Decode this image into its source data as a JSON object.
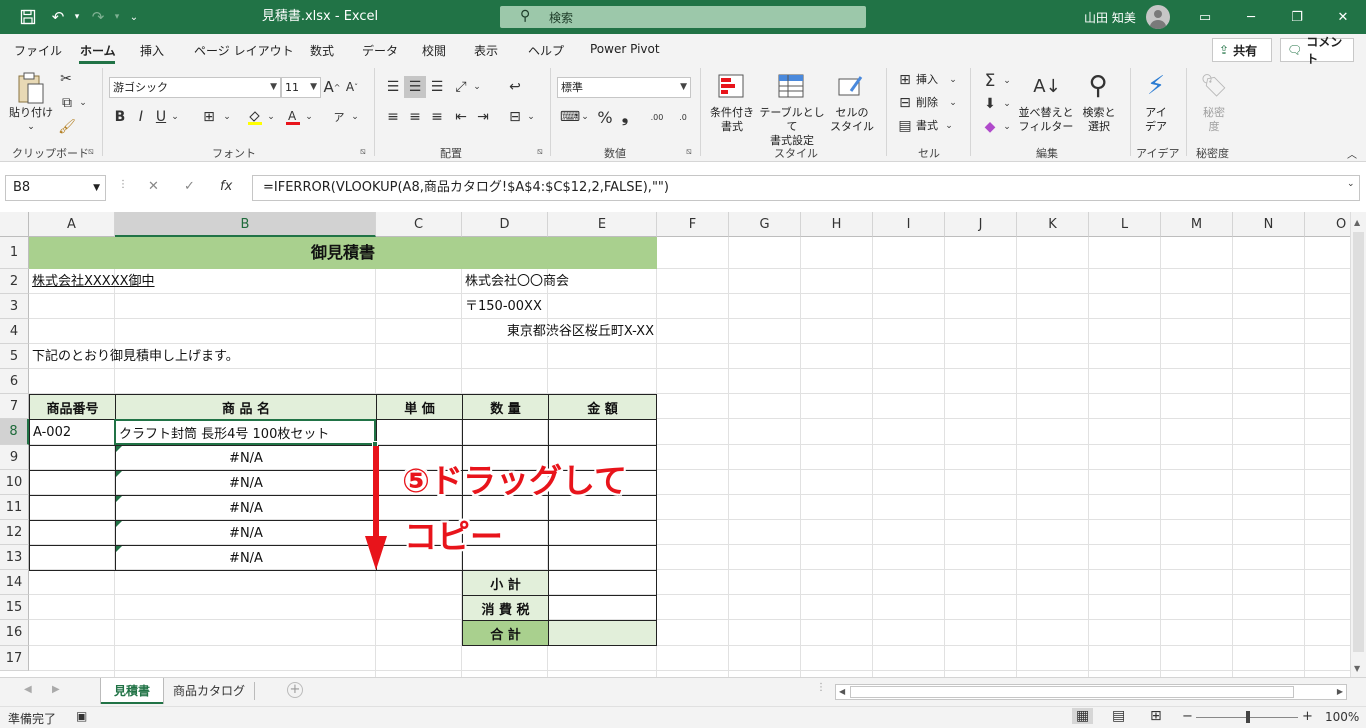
{
  "titlebar": {
    "filename": "見積書.xlsx",
    "sep": "-",
    "app": "Excel",
    "search_placeholder": "検索",
    "user": "山田 知美"
  },
  "tabs": [
    "ファイル",
    "ホーム",
    "挿入",
    "ページ レイアウト",
    "数式",
    "データ",
    "校閲",
    "表示",
    "ヘルプ",
    "Power Pivot"
  ],
  "share_label": "共有",
  "comment_label": "コメント",
  "ribbon": {
    "clipboard": {
      "paste": "貼り付け",
      "group": "クリップボード"
    },
    "font": {
      "name": "游ゴシック",
      "size": "11",
      "group": "フォント"
    },
    "alignment": {
      "group": "配置"
    },
    "number": {
      "format": "標準",
      "group": "数値"
    },
    "styles": {
      "conditional": "条件付き\n書式",
      "table": "テーブルとして\n書式設定",
      "cell_styles": "セルの\nスタイル",
      "group": "スタイル"
    },
    "cells": {
      "insert": "挿入",
      "delete": "削除",
      "format": "書式",
      "group": "セル"
    },
    "editing": {
      "sort": "並べ替えと\nフィルター",
      "find": "検索と\n選択",
      "group": "編集"
    },
    "ideas": {
      "label": "アイ\nデア",
      "group": "アイデア"
    },
    "sensitivity": {
      "label": "秘密\n度",
      "group": "秘密度"
    }
  },
  "formula_bar": {
    "name_box": "B8",
    "formula": "=IFERROR(VLOOKUP(A8,商品カタログ!$A$4:$C$12,2,FALSE),\"\")"
  },
  "columns": [
    "A",
    "B",
    "C",
    "D",
    "E",
    "F",
    "G",
    "H",
    "I",
    "J",
    "K",
    "L",
    "M",
    "N",
    "O"
  ],
  "rows": [
    "1",
    "2",
    "3",
    "4",
    "5",
    "6",
    "7",
    "8",
    "9",
    "10",
    "11",
    "12",
    "13",
    "14",
    "15",
    "16",
    "17"
  ],
  "sheet": {
    "title": "御見積書",
    "customer": "株式会社XXXXX御中",
    "company": "株式会社〇〇商会",
    "postal": "〒150-00XX",
    "address": "東京都渋谷区桜丘町X-XX",
    "greeting": "下記のとおり御見積申し上げます。",
    "headers": [
      "商品番号",
      "商 品 名",
      "単 価",
      "数 量",
      "金 額"
    ],
    "row8": {
      "code": "A-002",
      "name": "クラフト封筒 長形4号 100枚セット"
    },
    "na": [
      "#N/A",
      "#N/A",
      "#N/A",
      "#N/A",
      "#N/A"
    ],
    "subtotal": "小 計",
    "tax": "消 費 税",
    "total": "合 計"
  },
  "annotation": {
    "line1": "⑤ドラッグして",
    "line2": "コピー"
  },
  "sheet_tabs": [
    "見積書",
    "商品カタログ"
  ],
  "status": {
    "ready": "準備完了",
    "zoom": "100%"
  },
  "colors": {
    "excel_green": "#217346",
    "header_fill": "#e2efda",
    "title_fill": "#a9d08e",
    "annotation_red": "#e8141b"
  }
}
